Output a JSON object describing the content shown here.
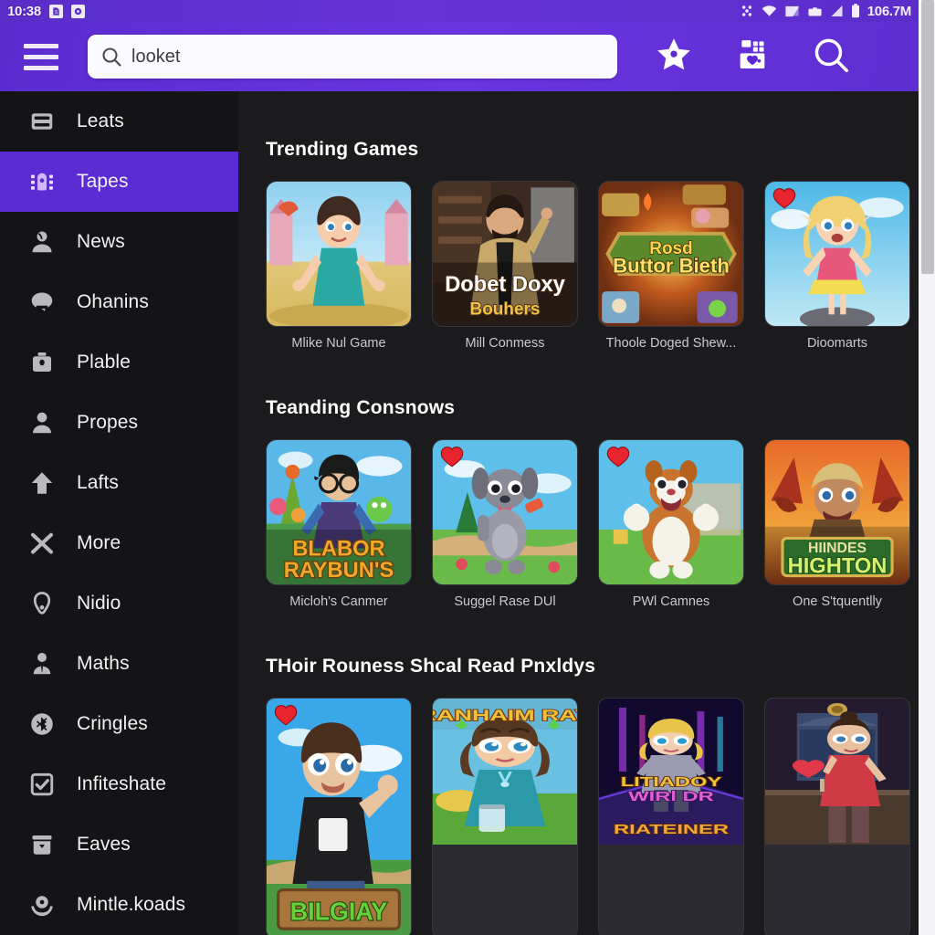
{
  "statusbar": {
    "clock": "10:38",
    "data_usage": "106.7M",
    "left_icons": [
      "sim-icon",
      "photo-icon"
    ],
    "right_icons": [
      "apps-dots-icon",
      "wifi-icon",
      "signal-triangle-icon",
      "briefcase-icon",
      "cell-signal-icon",
      "battery-icon"
    ]
  },
  "header": {
    "menu_icon": "hamburger-menu-icon",
    "search": {
      "value": "looket",
      "placeholder": "Search",
      "icon": "search-icon"
    },
    "actions": [
      {
        "name": "favorites-star-button",
        "icon": "star-icon"
      },
      {
        "name": "apps-grid-button",
        "icon": "apps-grid-icon"
      },
      {
        "name": "search-button",
        "icon": "search-icon"
      }
    ],
    "accent_color": "#5b2bd0"
  },
  "sidebar": {
    "active_index": 1,
    "active_color": "#5b2bd4",
    "items": [
      {
        "label": "Leats",
        "icon": "list-card-icon"
      },
      {
        "label": "Tapes",
        "icon": "tapes-icon"
      },
      {
        "label": "News",
        "icon": "person-news-icon"
      },
      {
        "label": "Ohanins",
        "icon": "chat-bubble-icon"
      },
      {
        "label": "Plable",
        "icon": "bag-icon"
      },
      {
        "label": "Propes",
        "icon": "person-icon"
      },
      {
        "label": "Lafts",
        "icon": "arrow-up-icon"
      },
      {
        "label": "More",
        "icon": "shuffle-x-icon"
      },
      {
        "label": "Nidio",
        "icon": "headset-icon"
      },
      {
        "label": "Maths",
        "icon": "person-tie-icon"
      },
      {
        "label": "Cringles",
        "icon": "bluetooth-circle-icon"
      },
      {
        "label": "Infiteshate",
        "icon": "checkbox-icon"
      },
      {
        "label": "Eaves",
        "icon": "inbox-icon"
      },
      {
        "label": "Mintle.koads",
        "icon": "download-circle-icon"
      }
    ]
  },
  "sections": [
    {
      "title": "Trending Games",
      "layout": "square",
      "cards": [
        {
          "caption": "Mlike Nul Game",
          "art": "girl-castle",
          "badge": "",
          "badge_sub": "",
          "heart": false
        },
        {
          "caption": "Mill Conmess",
          "art": "man-office",
          "badge": "Dobet Doxy",
          "badge_sub": "Bouhers",
          "heart": false
        },
        {
          "caption": "Thoole Doged Shew...",
          "art": "board-game",
          "badge": "Rosd",
          "badge_sub": "Buttor Bieth",
          "heart": false
        },
        {
          "caption": "Dioomarts",
          "art": "blonde-sky",
          "badge": "",
          "badge_sub": "",
          "heart": true
        }
      ]
    },
    {
      "title": "Teanding Consnows",
      "layout": "square",
      "cards": [
        {
          "caption": "Micloh's Canmer",
          "art": "boy-park",
          "badge": "BLABOR",
          "badge_sub": "RAYBUN'S",
          "heart": false
        },
        {
          "caption": "Suggel Rase DUl",
          "art": "grey-dog",
          "badge": "",
          "badge_sub": "",
          "heart": true
        },
        {
          "caption": "PWl Camnes",
          "art": "squirrel",
          "badge": "",
          "badge_sub": "",
          "heart": true
        },
        {
          "caption": "One S'tquentlly",
          "art": "dragon-man",
          "badge": "HIINDES",
          "badge_sub": "HIGHTON",
          "heart": false
        }
      ]
    },
    {
      "title": "THoir Rouness Shcal Read Pnxldys",
      "layout": "tall",
      "cards": [
        {
          "caption": "",
          "art": "kid-wave",
          "badge": "",
          "badge_sub": "BILGIAY",
          "heart": true
        },
        {
          "caption": "",
          "art": "girl-jar",
          "badge": "RANHAIM RAY",
          "badge_sub": "",
          "heart": false
        },
        {
          "caption": "",
          "art": "neon-girl",
          "badge": "LITIADOY WIRl DR",
          "badge_sub": "RIATEINER",
          "heart": false
        },
        {
          "caption": "",
          "art": "red-dress-girl",
          "badge": "",
          "badge_sub": "",
          "heart": false
        }
      ]
    }
  ],
  "scrollbar": {
    "position": "right",
    "thumb_top_pct": 0,
    "thumb_height_pct": 29
  }
}
